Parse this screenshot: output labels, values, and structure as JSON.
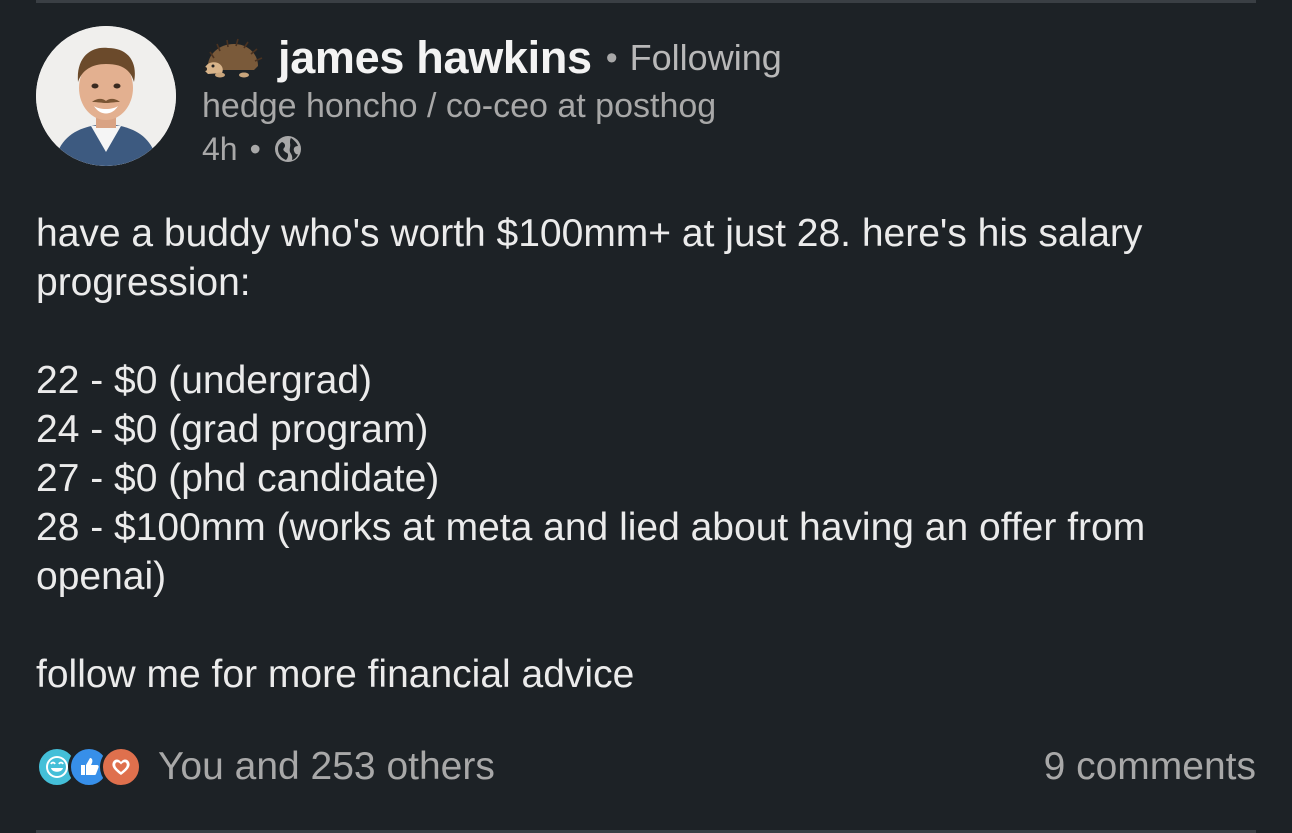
{
  "author": {
    "name": "james hawkins",
    "following_label": "Following",
    "headline": "hedge honcho / co-ceo at posthog",
    "time": "4h",
    "separator": "•"
  },
  "post": {
    "lines": [
      "have a buddy who's worth $100mm+ at just 28. here's his salary progression:",
      "",
      "22 - $0 (undergrad)",
      "24 - $0 (grad program)",
      "27 - $0 (phd candidate)",
      "28 - $100mm (works at meta and lied about having an offer from openai)",
      "",
      "follow me for more financial advice"
    ]
  },
  "social": {
    "reactions_text": "You and 253 others",
    "comments_text": "9 comments",
    "reaction_icons": [
      "funny-icon",
      "like-icon",
      "love-icon"
    ]
  },
  "colors": {
    "background": "#1d2226",
    "text": "#ebebeb",
    "muted": "#a8a8a8",
    "funny": "#44bfd8",
    "like": "#378fe9",
    "love": "#df704d"
  }
}
